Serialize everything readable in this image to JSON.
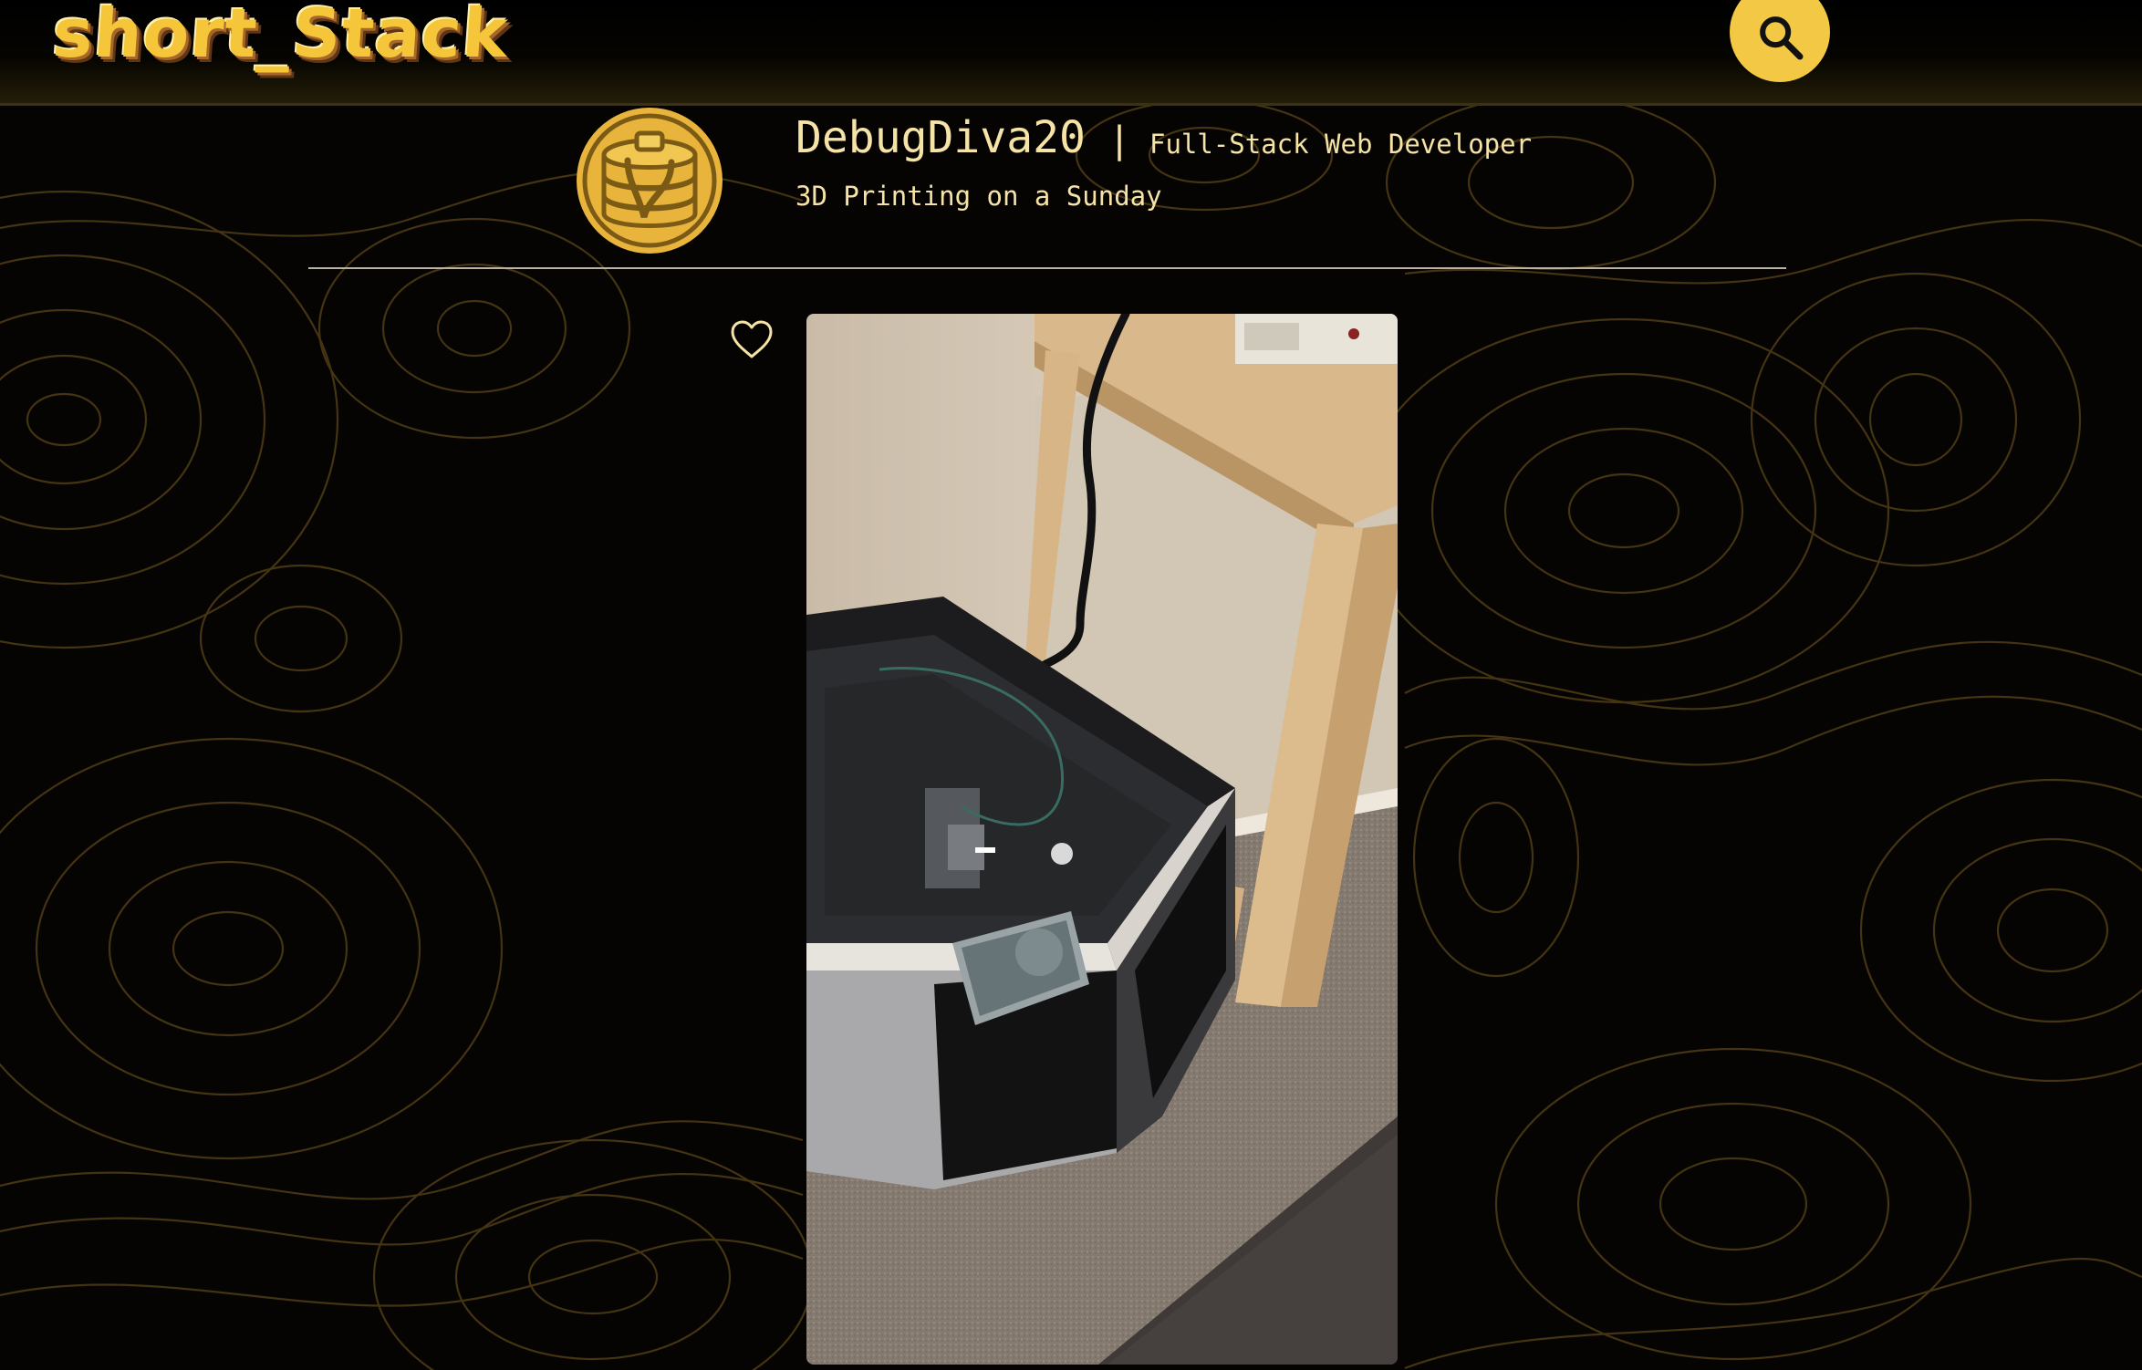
{
  "app": {
    "logo_text": "short_Stack"
  },
  "header": {
    "search_icon": "search-icon"
  },
  "profile": {
    "username": "DebugDiva20",
    "separator": "|",
    "role": "Full-Stack Web Developer",
    "post_title": "3D Printing on a Sunday",
    "avatar_icon": "pancake-stack-icon"
  },
  "post": {
    "like_icon": "heart-outline-icon",
    "media_subject": "3d-printer-photo"
  },
  "colors": {
    "accent": "#f3c844",
    "text": "#f6e3a6",
    "background": "#050403",
    "topo_lines": "#5a4516"
  }
}
